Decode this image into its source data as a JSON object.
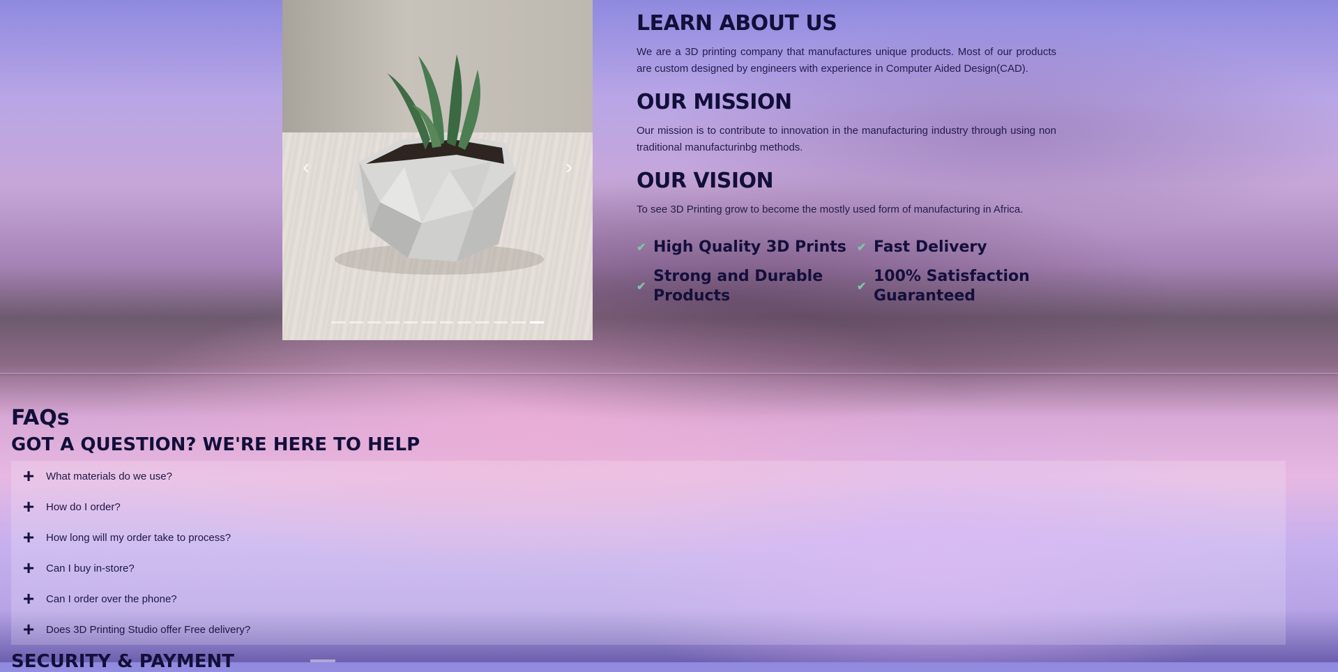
{
  "carousel": {
    "prev_icon": "chevron-left-icon",
    "next_icon": "chevron-right-icon",
    "prev_glyph": "‹",
    "next_glyph": "›",
    "slide_count": 12,
    "active_index": 11
  },
  "about": {
    "learn_title": "LEARN ABOUT US",
    "learn_text": "We are a 3D printing company that manufactures unique products. Most of our products are custom designed by engineers with experience in Computer Aided Design(CAD).",
    "mission_title": "OUR MISSION",
    "mission_text": "Our mission is to contribute to innovation in the manufacturing industry through using non traditional manufacturinbg methods.",
    "vision_title": "OUR VISION",
    "vision_text": "To see 3D Printing grow to become the mostly used form of manufacturing in Africa.",
    "features": [
      "High Quality 3D Prints",
      "Fast Delivery",
      "Strong and Durable Products",
      "100% Satisfaction Guaranteed"
    ],
    "check_icon": "check-icon",
    "check_color": "#7fc5a8"
  },
  "faq": {
    "title": "FAQs",
    "subtitle": "GOT A QUESTION? WE'RE HERE TO HELP",
    "expand_icon": "plus-icon",
    "questions": [
      "What materials do we use?",
      "How do I order?",
      "How long will my order take to process?",
      "Can I buy in-store?",
      "Can I order over the phone?",
      "Does 3D Printing Studio offer Free delivery?"
    ]
  },
  "next_section": {
    "title": "SECURITY & PAYMENT"
  }
}
